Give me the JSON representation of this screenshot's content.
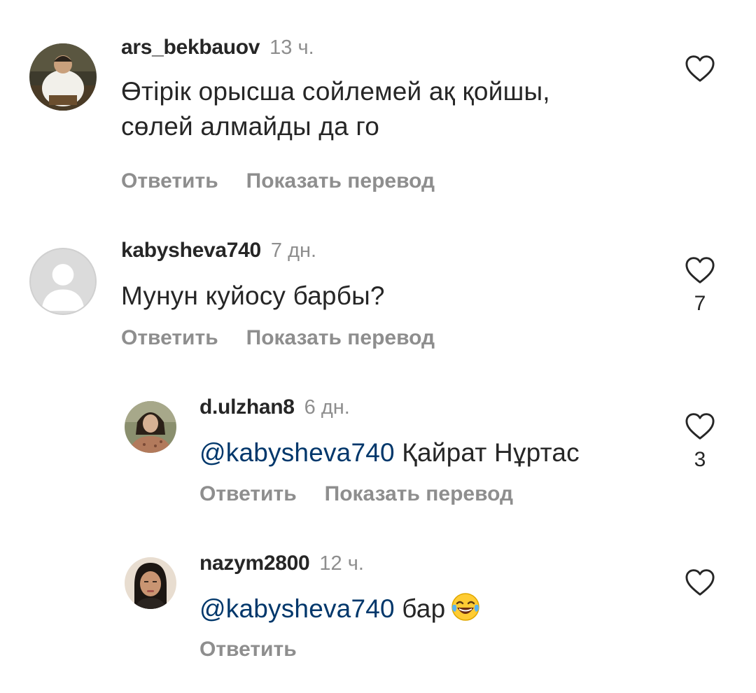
{
  "comments": [
    {
      "username": "ars_bekbauov",
      "time": "13 ч.",
      "text_line1": "Өтірік орысша сойлемей ақ қойшы,",
      "text_line2": "сөлей алмайды да го",
      "reply_label": "Ответить",
      "translate_label": "Показать перевод",
      "likes": ""
    },
    {
      "username": "kabysheva740",
      "time": "7 дн.",
      "text": "Мунун куйосу барбы?",
      "reply_label": "Ответить",
      "translate_label": "Показать перевод",
      "likes": "7"
    }
  ],
  "replies": [
    {
      "username": "d.ulzhan8",
      "time": "6 дн.",
      "mention": "@kabysheva740",
      "text": " Қайрат Нұртас",
      "reply_label": "Ответить",
      "translate_label": "Показать перевод",
      "likes": "3"
    },
    {
      "username": "nazym2800",
      "time": "12 ч.",
      "mention": "@kabysheva740",
      "text": " бар",
      "emoji": "face-with-tears-of-joy-emoji",
      "reply_label": "Ответить",
      "likes": ""
    }
  ],
  "colors": {
    "text": "#262626",
    "secondary": "#8e8e8e",
    "mention": "#00376b",
    "background": "#ffffff"
  },
  "icons": {
    "like": "heart-outline-icon",
    "default_avatar": "default-avatar-icon"
  }
}
